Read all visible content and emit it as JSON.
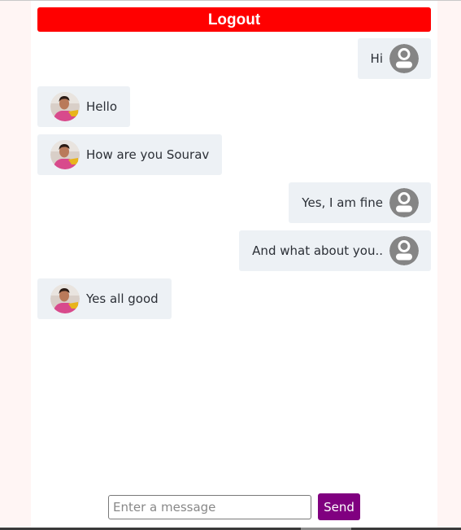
{
  "header": {
    "logout_label": "Logout"
  },
  "messages": [
    {
      "side": "right",
      "sender": "me",
      "text": "Hi"
    },
    {
      "side": "left",
      "sender": "other",
      "text": "Hello"
    },
    {
      "side": "left",
      "sender": "other",
      "text": "How are you Sourav"
    },
    {
      "side": "right",
      "sender": "me",
      "text": "Yes, I am fine"
    },
    {
      "side": "right",
      "sender": "me",
      "text": "And what about you.."
    },
    {
      "side": "left",
      "sender": "other",
      "text": "Yes all good"
    }
  ],
  "icons": {
    "me_avatar": "default-user-icon",
    "other_avatar": "profile-photo"
  },
  "composer": {
    "placeholder": "Enter a message",
    "value": "",
    "send_label": "Send"
  },
  "colors": {
    "logout_bg": "#ff0000",
    "send_bg": "#800080",
    "bubble_bg": "#edf1f5",
    "page_bg": "#fff5f4"
  }
}
